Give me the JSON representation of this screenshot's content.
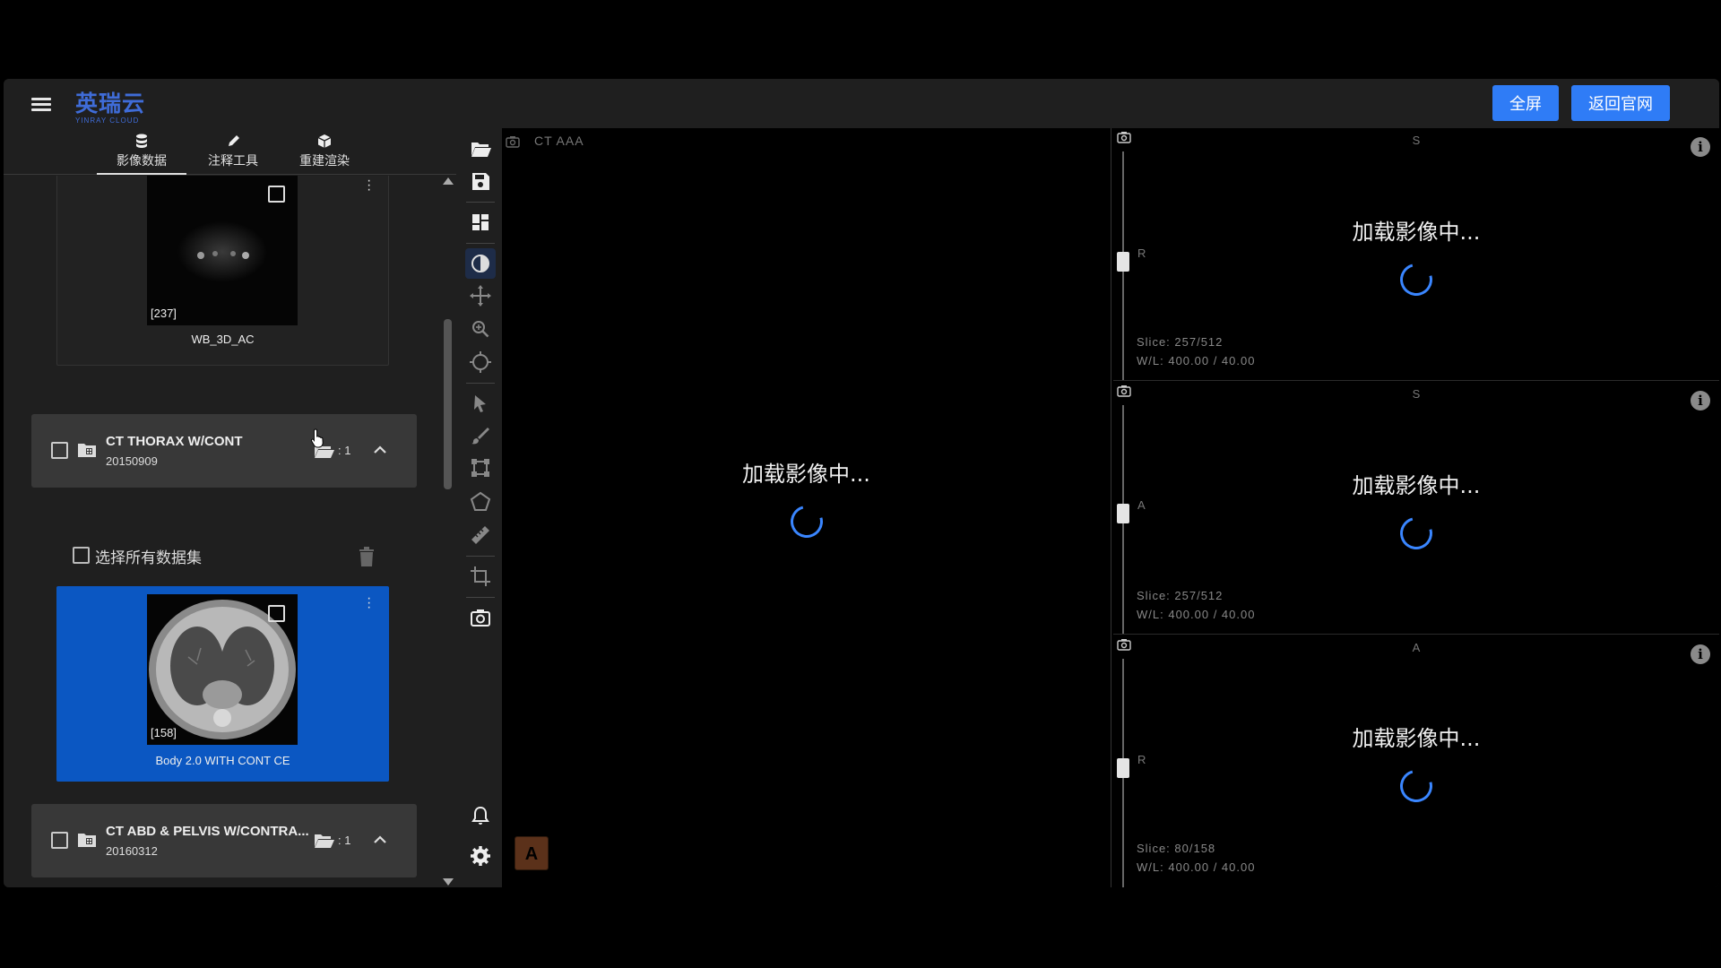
{
  "header": {
    "logo_cn": "英瑞云",
    "logo_en": "YINRAY CLOUD",
    "fullscreen_label": "全屏",
    "return_label": "返回官网"
  },
  "left_panel": {
    "tabs": [
      {
        "label": "影像数据",
        "icon": "database-icon",
        "active": true
      },
      {
        "label": "注释工具",
        "icon": "pencil-icon",
        "active": false
      },
      {
        "label": "重建渲染",
        "icon": "cube-icon",
        "active": false
      }
    ],
    "series_top": {
      "count": "[237]",
      "label": "WB_3D_AC"
    },
    "studies": [
      {
        "title": "CT THORAX W/CONT",
        "date": "20150909",
        "count": ": 1"
      },
      {
        "title": "CT ABD & PELVIS W/CONTRA...",
        "date": "20160312",
        "count": ": 1"
      }
    ],
    "select_all_label": "选择所有数据集",
    "series_selected": {
      "count": "[158]",
      "label": "Body 2.0 WITH CONT CE"
    }
  },
  "toolbar": {
    "tools": [
      "folder-open-icon",
      "save-icon",
      "layout-icon",
      "window-level-icon",
      "pan-icon",
      "zoom-icon",
      "crosshair-icon",
      "pointer-icon",
      "brush-icon",
      "bounding-box-icon",
      "polygon-icon",
      "ruler-icon",
      "crop-icon",
      "screenshot-icon",
      "bell-icon",
      "settings-icon"
    ],
    "active_tool": "window-level-icon"
  },
  "viewports": {
    "main": {
      "title": "CT AAA",
      "loading": "加载影像中...",
      "marker": "A"
    },
    "v1": {
      "top": "S",
      "left": "R",
      "loading": "加载影像中...",
      "slice": "Slice: 257/512",
      "wl": "W/L: 400.00 / 40.00"
    },
    "v2": {
      "top": "S",
      "left": "A",
      "loading": "加载影像中...",
      "slice": "Slice: 257/512",
      "wl": "W/L: 400.00 / 40.00"
    },
    "v3": {
      "top": "A",
      "left": "R",
      "loading": "加载影像中...",
      "slice": "Slice: 80/158",
      "wl": "W/L: 400.00 / 40.00"
    },
    "info_glyph": "i"
  },
  "colors": {
    "accent": "#2f7cf6",
    "selected_card": "#0b57c2",
    "spinner": "#3a86ff",
    "logo": "#3f6cd8"
  }
}
